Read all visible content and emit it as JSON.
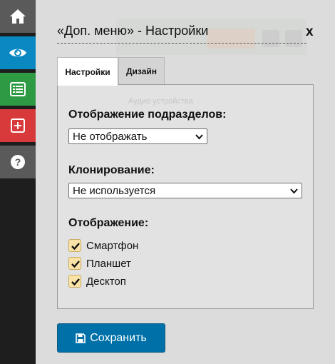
{
  "sidebar": {
    "items": [
      {
        "icon": "home-icon",
        "color": "#5a5a5a"
      },
      {
        "icon": "eye-icon",
        "color": "#0a88c2"
      },
      {
        "icon": "list-icon",
        "color": "#2e9a43"
      },
      {
        "icon": "plus-square-icon",
        "color": "#d8393a"
      },
      {
        "icon": "help-icon",
        "color": "#5a5a5a"
      }
    ]
  },
  "dialog": {
    "title": "«Доп. меню» - Настройки",
    "close_label": "x",
    "background_text": "Аудио устройства"
  },
  "tabs": [
    {
      "label": "Настройки",
      "active": true
    },
    {
      "label": "Дизайн",
      "active": false
    }
  ],
  "settings": {
    "subsections": {
      "label": "Отображение подразделов:",
      "selected": "Не отображать"
    },
    "cloning": {
      "label": "Клонирование:",
      "selected": "Не используется"
    },
    "display": {
      "label": "Отображение:",
      "options": [
        {
          "label": "Смартфон",
          "checked": true
        },
        {
          "label": "Планшет",
          "checked": true
        },
        {
          "label": "Десктоп",
          "checked": true
        }
      ]
    }
  },
  "actions": {
    "save_label": "Сохранить",
    "save_color": "#0071a8"
  }
}
